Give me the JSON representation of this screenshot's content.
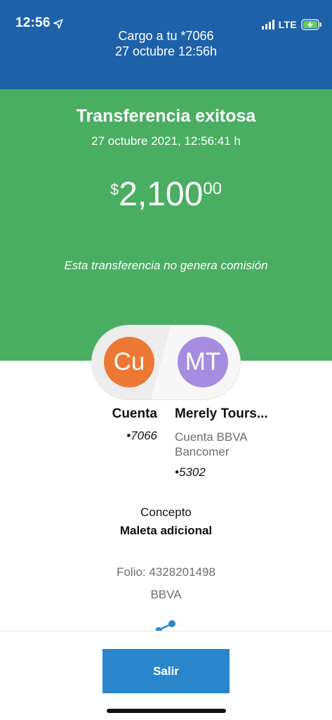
{
  "status_bar": {
    "time": "12:56",
    "network": "LTE",
    "icons": [
      "location-arrow-icon",
      "signal-icon",
      "battery-charging-icon"
    ]
  },
  "header": {
    "line1": "Cargo a tu *7066",
    "line2": "27 octubre 12:56h"
  },
  "success": {
    "title": "Transferencia exitosa",
    "datetime": "27 octubre 2021, 12:56:41 h",
    "amount_currency": "$",
    "amount_main": "2,100",
    "amount_cents": "00",
    "commission_note": "Esta transferencia no genera comisión"
  },
  "origin": {
    "initials": "Cu",
    "name": "Cuenta",
    "number": "•7066"
  },
  "destination": {
    "initials": "MT",
    "name": "Merely Tours...",
    "bank_line1": "Cuenta BBVA",
    "bank_line2": "Bancomer",
    "number": "•5302"
  },
  "details": {
    "concept_label": "Concepto",
    "concept_value": "Maleta adicional",
    "folio": "Folio: 4328201498",
    "bank": "BBVA"
  },
  "actions": {
    "exit_label": "Salir"
  },
  "colors": {
    "header_blue": "#1d61a9",
    "success_green": "#49ae62",
    "button_blue": "#2a86ca",
    "origin_avatar": "#ec7833",
    "destination_avatar": "#a68ce0"
  }
}
